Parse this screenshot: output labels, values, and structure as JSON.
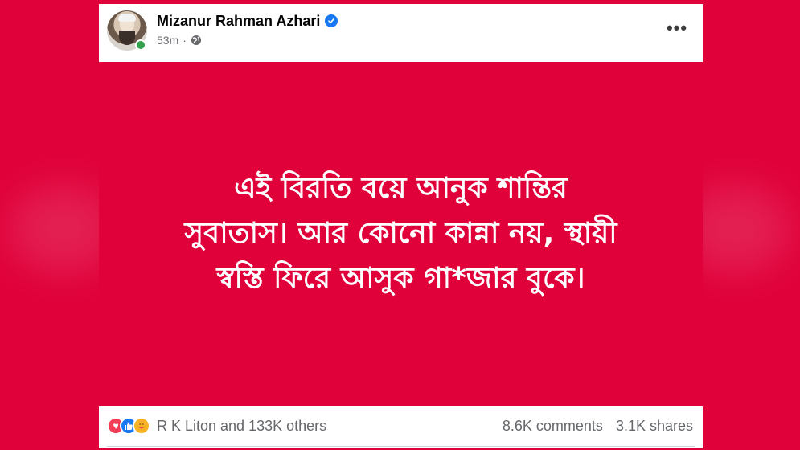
{
  "post": {
    "author": "Mizanur Rahman Azhari",
    "verified": true,
    "time": "53m",
    "separator": "·",
    "audience_icon": "globe-icon",
    "more_label": "•••",
    "online": true,
    "text_lines": [
      "এই বিরতি বয়ে আনুক শান্তির",
      "সুবাতাস। আর কোনো কান্না নয়, স্থায়ী",
      "স্বস্তি ফিরে আসুক গা*জার বুকে।"
    ],
    "background_color": "#e0003a",
    "text_color": "#ffffff"
  },
  "footer": {
    "reactions": [
      "love",
      "like",
      "care"
    ],
    "reaction_names": "R K Liton and 133K others",
    "comments": "8.6K comments",
    "shares": "3.1K shares"
  }
}
